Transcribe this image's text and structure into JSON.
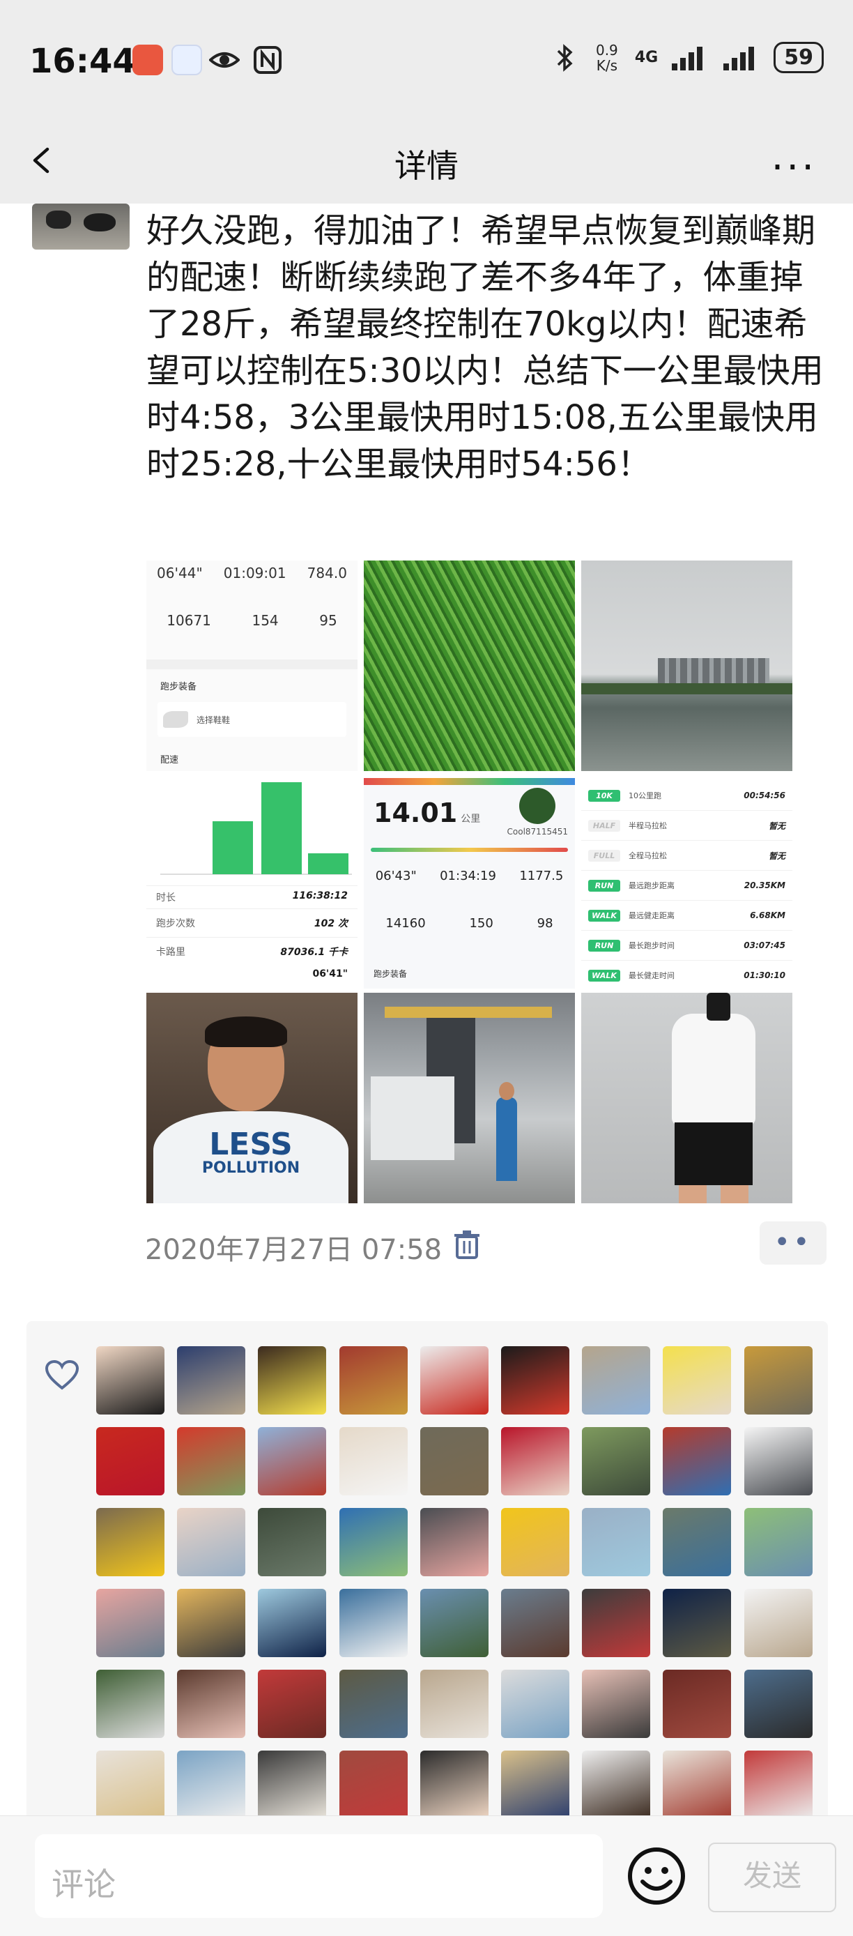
{
  "status_bar": {
    "time": "16:44",
    "network_speed": "0.9 K/s",
    "network_type": "4G",
    "battery": "59"
  },
  "nav": {
    "title": "详情"
  },
  "post": {
    "text": "好久没跑，得加油了！希望早点恢复到巅峰期的配速！断断续续跑了差不多4年了，体重掉了28斤，希望最终控制在70kg以内！配速希望可以控制在5:30以内！总结下一公里最快用时4:58，3公里最快用时15:08,五公里最快用时25:28,十公里最快用时54:56！",
    "timestamp": "2020年7月27日 07:58"
  },
  "photos": [
    {
      "kind": "app-stats",
      "stats_row1": [
        "06'44\"",
        "01:09:01",
        "784.0"
      ],
      "stats_row2": [
        "10671",
        "154",
        "95"
      ],
      "section": "跑步装备",
      "item": "选择鞋鞋",
      "footer": "配速"
    },
    {
      "kind": "grass"
    },
    {
      "kind": "lake-skyline"
    },
    {
      "kind": "bar-chart-summary",
      "rows": [
        {
          "label": "时长",
          "value": "116:38:12"
        },
        {
          "label": "跑步次数",
          "value": "102 次"
        },
        {
          "label": "卡路里",
          "value": "87036.1 千卡"
        }
      ],
      "partial": "06'41\""
    },
    {
      "kind": "distance-card",
      "distance": "14.01",
      "unit": "公里",
      "user": "Cool87115451",
      "stats_row1": [
        "06'43\"",
        "01:34:19",
        "1177.5"
      ],
      "stats_row2": [
        "14160",
        "150",
        "98"
      ],
      "section": "跑步装备"
    },
    {
      "kind": "records",
      "records": [
        {
          "tag": "10K",
          "label": "10公里跑",
          "value": "00:54:56"
        },
        {
          "tag": "HALF",
          "label": "半程马拉松",
          "value": "暂无"
        },
        {
          "tag": "FULL",
          "label": "全程马拉松",
          "value": "暂无"
        },
        {
          "tag": "RUN",
          "label": "最远跑步距离",
          "value": "20.35KM"
        },
        {
          "tag": "WALK",
          "label": "最远健走距离",
          "value": "6.68KM"
        },
        {
          "tag": "RUN",
          "label": "最长跑步时间",
          "value": "03:07:45"
        },
        {
          "tag": "WALK",
          "label": "最长健走时间",
          "value": "01:30:10"
        }
      ]
    },
    {
      "kind": "portrait",
      "shirt_line1": "LESS",
      "shirt_line2": "POLLUTION"
    },
    {
      "kind": "factory"
    },
    {
      "kind": "mirror-selfie"
    }
  ],
  "comment_bar": {
    "placeholder": "评论",
    "send_label": "发送"
  },
  "colors": {
    "accent_link": "#576b95",
    "background_gray": "#ededed",
    "record_green": "#2fbf71"
  },
  "icons": [
    "back-arrow-icon",
    "more-icon",
    "trash-icon",
    "heart-icon",
    "emoji-icon"
  ],
  "like_avatars_count": 54
}
